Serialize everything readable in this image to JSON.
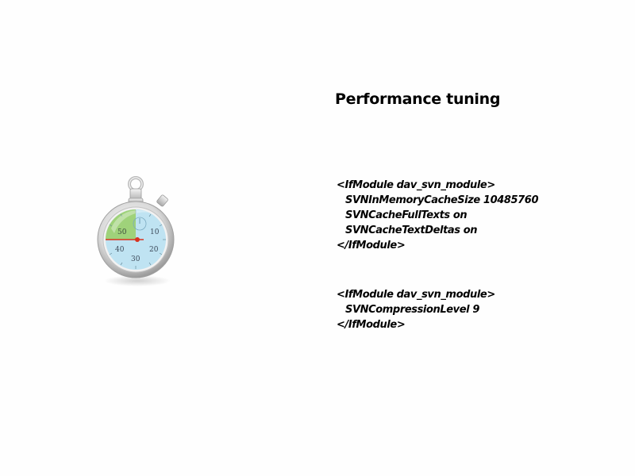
{
  "slide": {
    "title": "Performance tuning",
    "image": {
      "icon": "stopwatch-icon",
      "dial_labels": [
        "50",
        "10",
        "20",
        "30",
        "40"
      ]
    },
    "code_blocks": [
      {
        "lines": [
          "<IfModule dav_svn_module>",
          "SVNInMemoryCacheSize 10485760",
          "SVNCacheFullTexts on",
          "SVNCacheTextDeltas on",
          "</IfModule>"
        ]
      },
      {
        "lines": [
          "<IfModule dav_svn_module>",
          "SVNCompressionLevel 9",
          "</IfModule>"
        ]
      }
    ]
  },
  "colors": {
    "background": "#fefefe",
    "text": "#000000",
    "dial_green": "#9fd27a",
    "dial_blue": "#bfe3f2",
    "hand_red": "#d9321f"
  }
}
